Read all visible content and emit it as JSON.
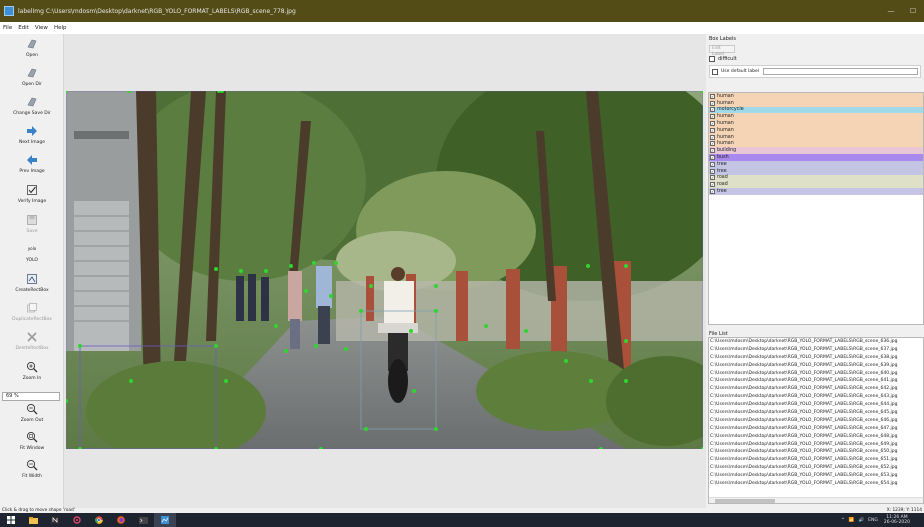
{
  "window": {
    "title": "labelImg C:\\Users\\mdosm\\Desktop\\darknet\\RGB_YOLO_FORMAT_LABELS\\RGB_scene_778.jpg",
    "minimize_glyph": "—",
    "maximize_glyph": "☐"
  },
  "menu": [
    "File",
    "Edit",
    "View",
    "Help"
  ],
  "toolbar": {
    "items": [
      {
        "label": "Open",
        "icon": "open-icon"
      },
      {
        "label": "Open Dir",
        "icon": "open-dir-icon"
      },
      {
        "label": "Change Save Dir",
        "icon": "change-save-dir-icon"
      },
      {
        "label": "Next Image",
        "icon": "next-image-icon"
      },
      {
        "label": "Prev Image",
        "icon": "prev-image-icon"
      },
      {
        "label": "Verify Image",
        "icon": "verify-image-icon"
      },
      {
        "label": "Save",
        "icon": "save-icon"
      },
      {
        "label": "YOLO",
        "icon": "yolo-icon",
        "glyph": "yolo"
      },
      {
        "label": "Create\\nRectBox",
        "icon": "create-rectbox-icon"
      },
      {
        "label": "Duplicate\\nRectBox",
        "icon": "duplicate-rectbox-icon"
      },
      {
        "label": "Delete\\nRectBox",
        "icon": "delete-rectbox-icon"
      },
      {
        "label": "Zoom In",
        "icon": "zoom-in-icon"
      },
      {
        "label": "Zoom Out",
        "icon": "zoom-out-icon"
      },
      {
        "label": "Fit Window",
        "icon": "fit-window-icon"
      },
      {
        "label": "Fit Width",
        "icon": "fit-width-icon"
      }
    ],
    "zoom_value": "69 %"
  },
  "box_labels": {
    "title": "Box Labels",
    "edit_label": "Edit Label",
    "difficult": "difficult",
    "use_default_label": "Use default label",
    "default_label_value": "",
    "items": [
      {
        "label": "human",
        "color": "#f4d4b4",
        "checked": true
      },
      {
        "label": "human",
        "color": "#f4d4b4",
        "checked": true
      },
      {
        "label": "motorcycle",
        "color": "#9fd9ea",
        "checked": true
      },
      {
        "label": "human",
        "color": "#f4d4b4",
        "checked": true
      },
      {
        "label": "human",
        "color": "#f4d4b4",
        "checked": true
      },
      {
        "label": "human",
        "color": "#f4d4b4",
        "checked": true
      },
      {
        "label": "human",
        "color": "#f4d4b4",
        "checked": true
      },
      {
        "label": "human",
        "color": "#f4d4b4",
        "checked": true
      },
      {
        "label": "building",
        "color": "#eac7d7",
        "checked": true
      },
      {
        "label": "bush",
        "color": "#a989ed",
        "checked": true
      },
      {
        "label": "tree",
        "color": "#c4c4e4",
        "checked": true
      },
      {
        "label": "tree",
        "color": "#c4c4e4",
        "checked": true
      },
      {
        "label": "road",
        "color": "#dfe0c8",
        "checked": true
      },
      {
        "label": "road",
        "color": "#dfe0c8",
        "checked": true
      },
      {
        "label": "tree",
        "color": "#c4c4e4",
        "checked": true
      }
    ]
  },
  "file_list": {
    "title": "File List",
    "files": [
      "C:\\Users\\mdosm\\Desktop\\darknet\\RGB_YOLO_FORMAT_LABELS\\RGB_scene_636.jpg",
      "C:\\Users\\mdosm\\Desktop\\darknet\\RGB_YOLO_FORMAT_LABELS\\RGB_scene_637.jpg",
      "C:\\Users\\mdosm\\Desktop\\darknet\\RGB_YOLO_FORMAT_LABELS\\RGB_scene_638.jpg",
      "C:\\Users\\mdosm\\Desktop\\darknet\\RGB_YOLO_FORMAT_LABELS\\RGB_scene_639.jpg",
      "C:\\Users\\mdosm\\Desktop\\darknet\\RGB_YOLO_FORMAT_LABELS\\RGB_scene_640.jpg",
      "C:\\Users\\mdosm\\Desktop\\darknet\\RGB_YOLO_FORMAT_LABELS\\RGB_scene_641.jpg",
      "C:\\Users\\mdosm\\Desktop\\darknet\\RGB_YOLO_FORMAT_LABELS\\RGB_scene_642.jpg",
      "C:\\Users\\mdosm\\Desktop\\darknet\\RGB_YOLO_FORMAT_LABELS\\RGB_scene_643.jpg",
      "C:\\Users\\mdosm\\Desktop\\darknet\\RGB_YOLO_FORMAT_LABELS\\RGB_scene_644.jpg",
      "C:\\Users\\mdosm\\Desktop\\darknet\\RGB_YOLO_FORMAT_LABELS\\RGB_scene_645.jpg",
      "C:\\Users\\mdosm\\Desktop\\darknet\\RGB_YOLO_FORMAT_LABELS\\RGB_scene_646.jpg",
      "C:\\Users\\mdosm\\Desktop\\darknet\\RGB_YOLO_FORMAT_LABELS\\RGB_scene_647.jpg",
      "C:\\Users\\mdosm\\Desktop\\darknet\\RGB_YOLO_FORMAT_LABELS\\RGB_scene_648.jpg",
      "C:\\Users\\mdosm\\Desktop\\darknet\\RGB_YOLO_FORMAT_LABELS\\RGB_scene_649.jpg",
      "C:\\Users\\mdosm\\Desktop\\darknet\\RGB_YOLO_FORMAT_LABELS\\RGB_scene_650.jpg",
      "C:\\Users\\mdosm\\Desktop\\darknet\\RGB_YOLO_FORMAT_LABELS\\RGB_scene_651.jpg",
      "C:\\Users\\mdosm\\Desktop\\darknet\\RGB_YOLO_FORMAT_LABELS\\RGB_scene_652.jpg",
      "C:\\Users\\mdosm\\Desktop\\darknet\\RGB_YOLO_FORMAT_LABELS\\RGB_scene_653.jpg",
      "C:\\Users\\mdosm\\Desktop\\darknet\\RGB_YOLO_FORMAT_LABELS\\RGB_scene_654.jpg"
    ]
  },
  "status": {
    "message": "Click & drag to move shape 'road'",
    "coords": "X: 1239; Y: 1114"
  },
  "taskbar": {
    "tray_lang": "ENG",
    "time": "11:26 AM",
    "date": "26-06-2020"
  }
}
